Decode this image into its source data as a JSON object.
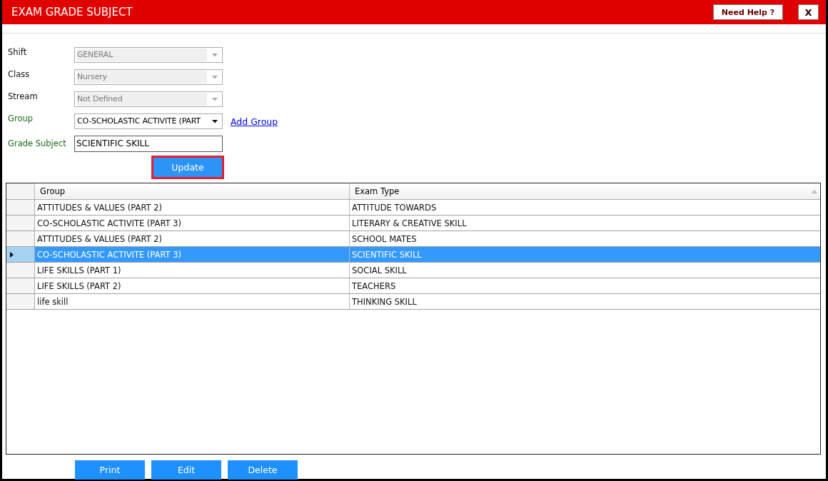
{
  "window": {
    "title": "EXAM GRADE SUBJECT",
    "help_button": "Need Help ?",
    "close_button": "X"
  },
  "fields": [
    {
      "label": "Shift",
      "kind": "dropdown",
      "value": "GENERAL",
      "disabled": true,
      "required": false
    },
    {
      "label": "Class",
      "kind": "dropdown",
      "value": "Nursery",
      "disabled": true,
      "required": false
    },
    {
      "label": "Stream",
      "kind": "dropdown",
      "value": "Not Defined",
      "disabled": true,
      "required": false
    },
    {
      "label": "Group",
      "kind": "dropdown",
      "value": "CO-SCHOLASTIC ACTIVITE (PART",
      "disabled": false,
      "required": true,
      "link": "Add Group"
    },
    {
      "label": "Grade Subject",
      "kind": "text",
      "value": "SCIENTIFIC SKILL",
      "disabled": false,
      "required": true
    }
  ],
  "update_button": "Update",
  "table": {
    "columns": [
      "Group",
      "Exam Type"
    ],
    "rows": [
      {
        "cells": [
          "ATTITUDES & VALUES (PART 2)",
          "ATTITUDE TOWARDS"
        ],
        "selected": false
      },
      {
        "cells": [
          "CO-SCHOLASTIC ACTIVITE (PART 3)",
          "LITERARY & CREATIVE SKILL"
        ],
        "selected": false
      },
      {
        "cells": [
          "ATTITUDES & VALUES (PART 2)",
          "SCHOOL MATES"
        ],
        "selected": false
      },
      {
        "cells": [
          "CO-SCHOLASTIC ACTIVITE (PART 3)",
          "SCIENTIFIC SKILL"
        ],
        "selected": true
      },
      {
        "cells": [
          "LIFE SKILLS (PART 1)",
          "SOCIAL SKILL"
        ],
        "selected": false
      },
      {
        "cells": [
          "LIFE SKILLS (PART 2)",
          "TEACHERS"
        ],
        "selected": false
      },
      {
        "cells": [
          "life skill",
          "THINKING SKILL"
        ],
        "selected": false
      }
    ]
  },
  "buttons": [
    "Print",
    "Edit",
    "Delete"
  ]
}
